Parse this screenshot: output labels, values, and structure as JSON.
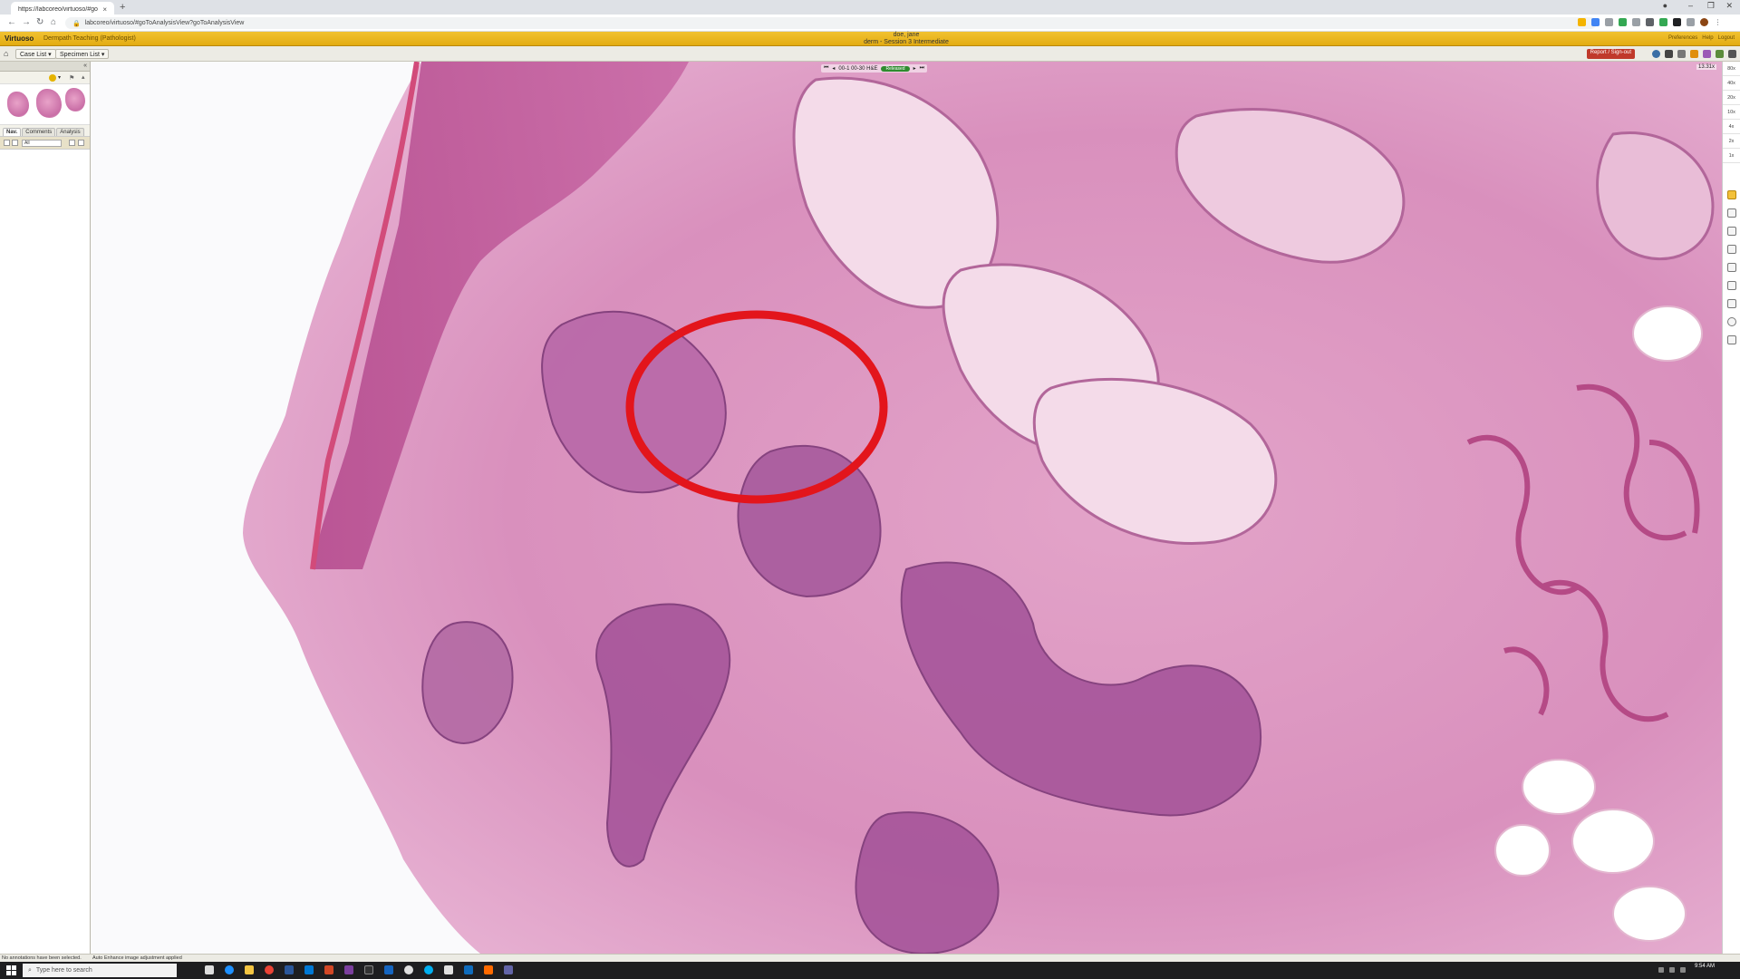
{
  "browser": {
    "tab_title": "https://labcoreo/virtuoso/#go",
    "tab_close": "×",
    "new_tab": "+",
    "url": "labcoreo/virtuoso/#goToAnalysisView?goToAnalysisView"
  },
  "app": {
    "name": "Virtuoso",
    "context": "Dermpath Teaching (Pathologist)",
    "user_name": "doe, jane",
    "session": "derm - Session 3 Intermediate",
    "links": [
      "Preferences",
      "Help",
      "Logout"
    ]
  },
  "toolbar": {
    "case_list_label": "Case List",
    "specimen_list_label": "Specimen List",
    "report_button": "Report / Sign-out"
  },
  "left_panel": {
    "tabs": [
      "Nav.",
      "Comments",
      "Analysis"
    ],
    "filter_label": "All"
  },
  "viewer": {
    "slide_label": "00-1 00-30 H&E",
    "status_badge": "Released",
    "zoom_readout": "13.31x",
    "annotation_color": "#e3151c"
  },
  "right_rail": {
    "magnifications": [
      "80x",
      "40x",
      "20x",
      "10x",
      "4x",
      "2x",
      "1x"
    ]
  },
  "status_bar": {
    "left_text": "No annotations have been selected.",
    "message": "Auto Enhance image adjustment applied"
  },
  "taskbar": {
    "search_placeholder": "Type here to search",
    "time": "9:54 AM"
  },
  "colors": {
    "header_accent": "#f1c232",
    "released": "#2e8b2e",
    "report_button": "#c0392b"
  }
}
